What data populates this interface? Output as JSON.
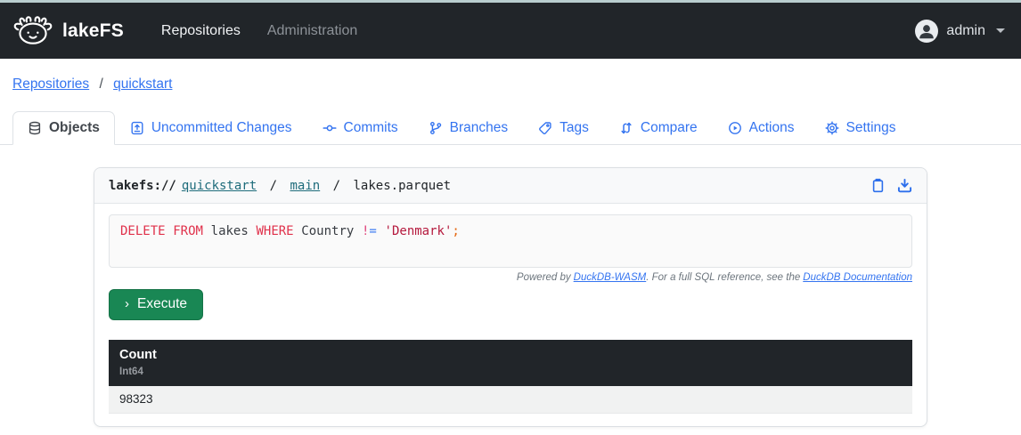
{
  "navbar": {
    "brand": "lakeFS",
    "links": [
      {
        "label": "Repositories"
      },
      {
        "label": "Administration"
      }
    ],
    "user": {
      "name": "admin"
    }
  },
  "breadcrumb": {
    "items": [
      "Repositories",
      "quickstart"
    ],
    "separator": "/"
  },
  "tabs": [
    {
      "label": "Objects",
      "icon": "database-icon",
      "active": true
    },
    {
      "label": "Uncommitted Changes",
      "icon": "file-diff-icon",
      "active": false
    },
    {
      "label": "Commits",
      "icon": "commit-icon",
      "active": false
    },
    {
      "label": "Branches",
      "icon": "branch-icon",
      "active": false
    },
    {
      "label": "Tags",
      "icon": "tag-icon",
      "active": false
    },
    {
      "label": "Compare",
      "icon": "compare-icon",
      "active": false
    },
    {
      "label": "Actions",
      "icon": "play-circle-icon",
      "active": false
    },
    {
      "label": "Settings",
      "icon": "gear-icon",
      "active": false
    }
  ],
  "object_pane": {
    "path": {
      "scheme": "lakefs://",
      "repo": "quickstart",
      "separator": "/",
      "ref": "main",
      "file": "lakes.parquet"
    },
    "sql": {
      "kw_delete": "DELETE",
      "kw_from": "FROM",
      "table": "lakes",
      "kw_where": "WHERE",
      "column": "Country",
      "op_not": "!",
      "op_eq": "=",
      "string": "'Denmark'",
      "semicolon": ";"
    },
    "powered": {
      "prefix": "Powered by",
      "link_duckdb": "DuckDB-WASM",
      "middle": ". For a full SQL reference, see the",
      "link_docs": "DuckDB Documentation"
    },
    "execute": {
      "chevron": "›",
      "label": "Execute"
    },
    "results": {
      "columns": [
        {
          "name": "Count",
          "type": "Int64"
        }
      ],
      "rows": [
        [
          "98323"
        ]
      ]
    }
  },
  "colors": {
    "link_blue": "#3474f0",
    "teal_link": "#1e6c7b",
    "keyword_red": "#e0314b",
    "string_red": "#b5193d",
    "operator_pink": "#e0447c",
    "operator_blue": "#3c7bf1",
    "semicolon_orange": "#e4650e",
    "success_green": "#198754",
    "navbar_dark": "#212529"
  }
}
